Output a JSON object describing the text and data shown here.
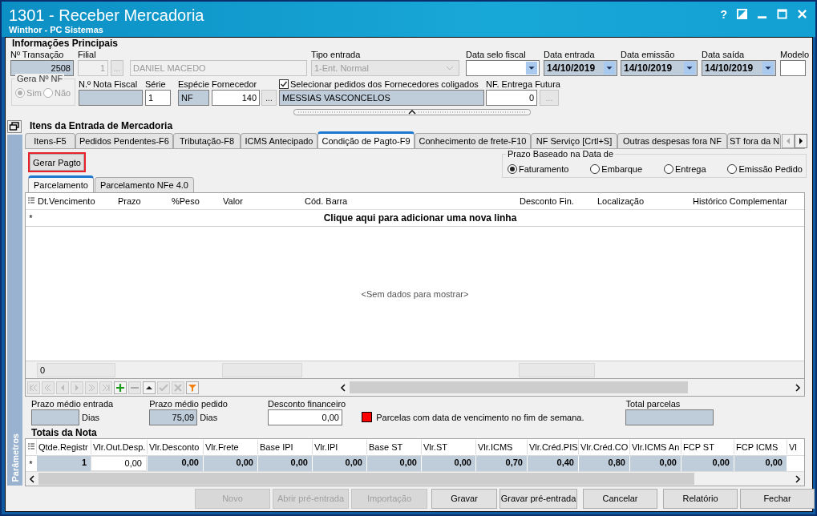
{
  "window": {
    "title": "1301 - Receber Mercadoria",
    "subtitle": "Winthor - PC Sistemas",
    "help": "?"
  },
  "main_info": {
    "title": "Informações Principais",
    "row1": [
      {
        "label": "Nº Transação",
        "kind": "readonly",
        "value": "2508"
      },
      {
        "label": "Filial",
        "kind": "disabled",
        "value": "1"
      },
      {
        "kind": "lookup",
        "value": "...",
        "disabled": true
      },
      {
        "kind": "disabled",
        "value": "DANIEL MACEDO"
      },
      {
        "label": "Tipo entrada",
        "kind": "combo",
        "value": "1-Ent. Normal",
        "disabled": true
      },
      {
        "label": "Data selo fiscal",
        "kind": "combo",
        "disabled": false
      },
      {
        "label": "Data entrada",
        "kind": "date",
        "value": "14/10/2019"
      },
      {
        "label": "Data emissão",
        "kind": "date",
        "value": "14/10/2019"
      },
      {
        "label": "Data saída",
        "kind": "date",
        "value": "14/10/2019"
      },
      {
        "label": "Modelo",
        "kind": "input"
      }
    ],
    "row2": [
      {
        "kind": "radio_group",
        "label": "Gera Nº NF",
        "disabled": true,
        "options": [
          {
            "label": "Sim",
            "selected": true
          },
          {
            "label": "Não",
            "selected": false
          }
        ]
      },
      {
        "label": "N.º Nota Fiscal",
        "kind": "readonly"
      },
      {
        "label": "Série",
        "kind": "input",
        "value": "1"
      },
      {
        "label": "Espécie",
        "kind": "readonly",
        "value": "NF"
      },
      {
        "label": "Fornecedor",
        "kind": "input",
        "value": "140"
      },
      {
        "kind": "lookup",
        "value": "...",
        "disabled": false
      },
      {
        "kind": "checkfield",
        "label": "Selecionar pedidos dos Fornecedores coligados",
        "checked": true,
        "value": "MESSIAS VASCONCELOS"
      },
      {
        "label": "NF. Entrega Futura",
        "kind": "input",
        "value": "0"
      },
      {
        "kind": "lookup",
        "value": "...",
        "disabled": true
      }
    ]
  },
  "sidebar": {
    "label": "Parâmetros"
  },
  "items": {
    "title": "Itens da Entrada de Mercadoria",
    "tabs": [
      {
        "label": "Itens-F5",
        "selected": false
      },
      {
        "label": "Pedidos Pendentes-F6",
        "selected": false
      },
      {
        "label": "Tributação-F8",
        "selected": false
      },
      {
        "label": "ICMS Antecipado",
        "selected": false
      },
      {
        "label": "Condição de Pagto-F9",
        "selected": true
      },
      {
        "label": "Conhecimento de frete-F10",
        "selected": false
      },
      {
        "label": "NF Serviço [Crtl+S]",
        "selected": false
      },
      {
        "label": "Outras despesas fora NF",
        "selected": false
      },
      {
        "label": "ST fora da N",
        "selected": false
      }
    ],
    "action_button": "Gerar Pagto",
    "prazo": {
      "title": "Prazo Baseado na Data de",
      "options": [
        {
          "label": "Faturamento",
          "selected": true
        },
        {
          "label": "Embarque",
          "selected": false
        },
        {
          "label": "Entrega",
          "selected": false
        },
        {
          "label": "Emissão Pedido",
          "selected": false
        }
      ]
    },
    "subtabs": [
      {
        "label": "Parcelamento",
        "selected": true
      },
      {
        "label": "Parcelamento NFe 4.0",
        "selected": false
      }
    ],
    "grid": {
      "columns": [
        "Dt.Vencimento",
        "Prazo",
        "%Peso",
        "Valor",
        "Cód. Barra",
        "Desconto Fin.",
        "Localização",
        "Histórico Complementar"
      ],
      "new_row_marker": "*",
      "new_row_text": "Clique aqui para adicionar uma nova linha",
      "empty_text": "<Sem dados para mostrar>",
      "footer_value": "0"
    },
    "summary": [
      {
        "label": "Prazo médio entrada",
        "suffix": "Dias"
      },
      {
        "label": "Prazo médio pedido",
        "value": "75,09",
        "suffix": "Dias"
      },
      {
        "label": "Desconto financeiro",
        "value": "0,00",
        "kind": "input"
      }
    ],
    "legend": "Parcelas com data de vencimento no fim de semana.",
    "total_parcelas": {
      "label": "Total parcelas"
    },
    "totals": {
      "title": "Totais da Nota",
      "marker": "*",
      "columns": [
        {
          "label": "Qtde.Registr",
          "value": "1"
        },
        {
          "label": "Vlr.Out.Desp.",
          "value": "0,00",
          "kind": "input"
        },
        {
          "label": "Vlr.Desconto",
          "value": "0,00"
        },
        {
          "label": "Vlr.Frete",
          "value": "0,00"
        },
        {
          "label": "Base IPI",
          "value": "0,00"
        },
        {
          "label": "Vlr.IPI",
          "value": "0,00"
        },
        {
          "label": "Base ST",
          "value": "0,00"
        },
        {
          "label": "Vlr.ST",
          "value": "0,00"
        },
        {
          "label": "Vlr.ICMS",
          "value": "0,70"
        },
        {
          "label": "Vlr.Créd.PIS",
          "value": "0,40"
        },
        {
          "label": "Vlr.Créd.CO",
          "value": "0,80"
        },
        {
          "label": "Vlr.ICMS An",
          "value": "0,00"
        },
        {
          "label": "FCP ST",
          "value": "0,00"
        },
        {
          "label": "FCP ICMS",
          "value": "0,00"
        },
        {
          "label": "Vl"
        }
      ]
    }
  },
  "buttons": [
    {
      "label": "Novo",
      "disabled": true
    },
    {
      "label": "Abrir pré-entrada",
      "disabled": true
    },
    {
      "label": "Importação",
      "disabled": true
    },
    {
      "label": "Gravar",
      "disabled": false
    },
    {
      "label": "Gravar pré-entrada",
      "disabled": false
    },
    {
      "label": "Cancelar",
      "disabled": false
    },
    {
      "label": "Relatório",
      "disabled": false
    },
    {
      "label": "Fechar",
      "disabled": false
    }
  ]
}
